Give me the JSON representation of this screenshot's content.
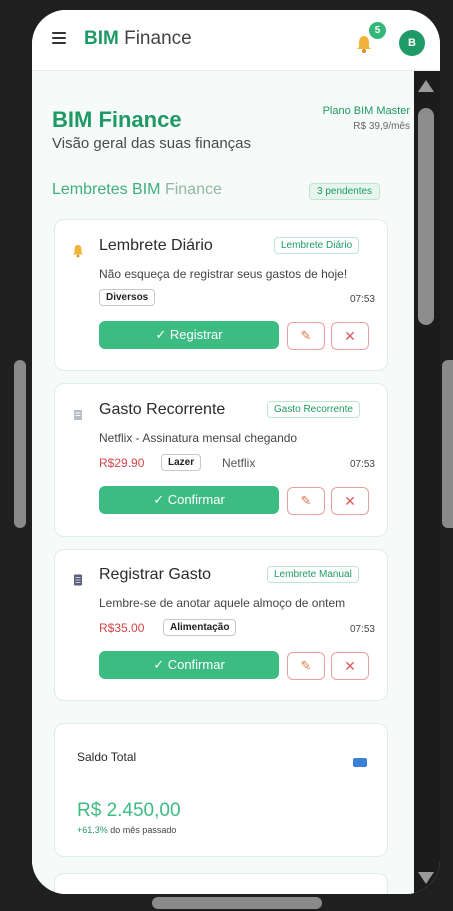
{
  "header": {
    "brand_bold": "BIM",
    "brand_rest": "Finance",
    "notification_count": "5",
    "avatar_initial": "B"
  },
  "page": {
    "title": "BIM Finance",
    "subtitle": "Visão geral das suas finanças",
    "plan_name": "Plano BIM Master",
    "plan_price": "R$ 39,9/mês"
  },
  "reminders": {
    "title_main": "Lembretes BIM",
    "title_suffix": "Finance",
    "pending": "3 pendentes",
    "items": [
      {
        "icon": "bell-icon",
        "title": "Lembrete Diário",
        "tag": "Lembrete Diário",
        "description": "Não esqueça de registrar seus gastos de hoje!",
        "category": "Diversos",
        "amount": "",
        "merchant": "",
        "time": "07:53",
        "action": "✓  Registrar"
      },
      {
        "icon": "receipt-icon",
        "title": "Gasto Recorrente",
        "tag": "Gasto Recorrente",
        "description": "Netflix - Assinatura mensal chegando",
        "category": "Lazer",
        "amount": "R$29.90",
        "merchant": "Netflix",
        "time": "07:53",
        "action": "✓  Confirmar"
      },
      {
        "icon": "note-icon",
        "title": "Registrar Gasto",
        "tag": "Lembrete Manual",
        "description": "Lembre-se de anotar aquele almoço de ontem",
        "category": "Alimentação",
        "amount": "R$35.00",
        "merchant": "",
        "time": "07:53",
        "action": "✓  Confirmar"
      }
    ],
    "edit_symbol": "✎",
    "delete_symbol": "✕"
  },
  "balance": {
    "label": "Saldo Total",
    "value": "R$ 2.450,00",
    "change_pct": "+61.3%",
    "change_text": "do mês passado",
    "icon": "credit-card-icon"
  },
  "colors": {
    "accent": "#1f9a66",
    "button": "#3cbc82",
    "amount": "#d64545"
  }
}
